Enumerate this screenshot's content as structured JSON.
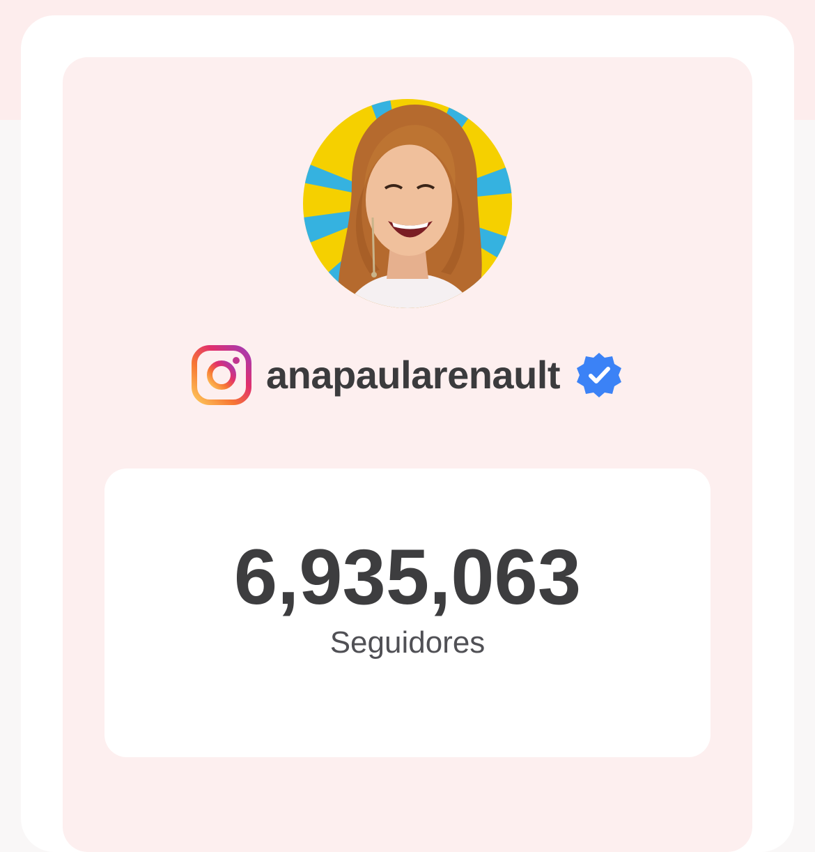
{
  "profile": {
    "handle": "anapaularenault",
    "platform_icon": "instagram-icon",
    "verified_icon": "verified-badge-icon",
    "avatar_description_icon": "profile-photo"
  },
  "stats": {
    "followers_count": "6,935,063",
    "followers_label": "Seguidores"
  },
  "colors": {
    "top_band": "#fdeded",
    "card": "#ffffff",
    "panel": "#fdefef",
    "text_dark": "#3d3d3f",
    "verified_blue": "#3b82f6",
    "avatar_yellow": "#f5d000",
    "avatar_blue": "#35b2e0"
  }
}
